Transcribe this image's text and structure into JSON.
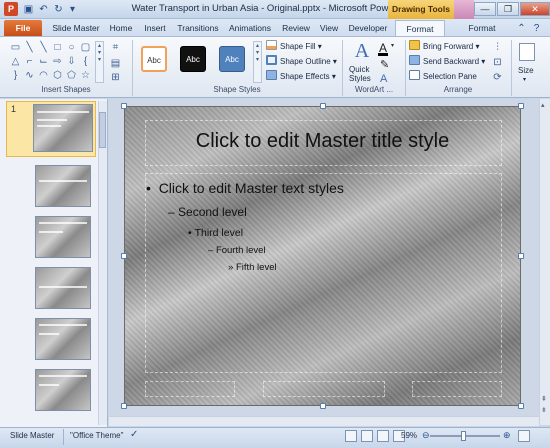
{
  "window": {
    "title": "Water Transport in Urban Asia - Original.pptx - Microsoft PowerPoint",
    "app_icon_letter": "P",
    "contextual_group": "Drawing Tools",
    "minimize": "—",
    "maximize": "❐",
    "close": "✕"
  },
  "tabs": [
    "File",
    "Slide Master",
    "Home",
    "Insert",
    "Transitions",
    "Animations",
    "Review",
    "View",
    "Developer",
    "Format",
    "Format"
  ],
  "ribbon": {
    "groups": {
      "insert_shapes": "Insert Shapes",
      "shape_styles": "Shape Styles",
      "wordart": "WordArt ...",
      "arrange": "Arrange"
    },
    "style_swatch_label": "Abc",
    "shape_fill": "Shape Fill",
    "shape_outline": "Shape Outline",
    "shape_effects": "Shape Effects",
    "quick_styles_line1": "Quick",
    "quick_styles_line2": "Styles",
    "bring_forward": "Bring Forward",
    "send_backward": "Send Backward",
    "selection_pane": "Selection Pane",
    "size": "Size"
  },
  "slides": {
    "selected_number": "1"
  },
  "slide": {
    "title": "Click to edit Master title style",
    "level1": "Click to edit Master text styles",
    "level2": "Second level",
    "level3": "Third level",
    "level4": "Fourth level",
    "level5": "Fifth level"
  },
  "status": {
    "view_name": "Slide Master",
    "theme": "\"Office Theme\"",
    "zoom": "59%",
    "zoom_fraction": 0.59
  }
}
